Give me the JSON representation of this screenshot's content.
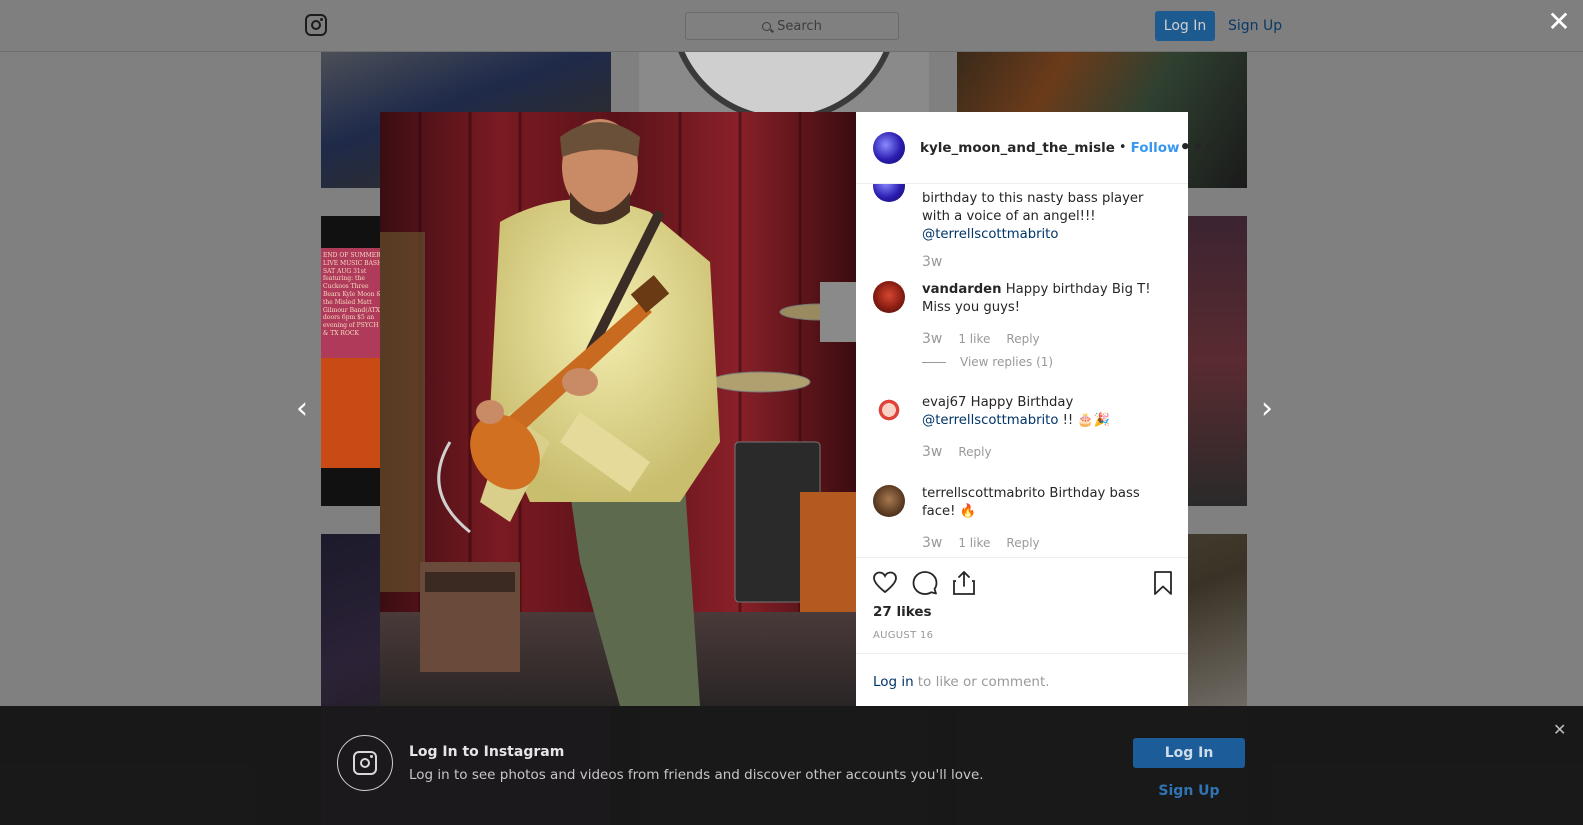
{
  "header": {
    "search_placeholder": "Search",
    "login_label": "Log In",
    "signup_label": "Sign Up",
    "close_label": "✕"
  },
  "nav": {
    "prev_label": "‹",
    "next_label": "›"
  },
  "post": {
    "username": "kyle_moon_and_the_misle",
    "separator": "•",
    "follow_label": "Follow",
    "more_label": "•••",
    "caption": {
      "text": "birthday to this nasty bass player with a voice of an angel!!!",
      "mention": "@terrellscottmabrito",
      "ago": "3w"
    },
    "comments": [
      {
        "username": "vandarden",
        "text": "Happy birthday Big T! Miss you guys!",
        "ago": "3w",
        "likes": "1 like",
        "reply": "Reply",
        "view_replies": "View replies (1)"
      },
      {
        "username": "evaj67",
        "text": "Happy Birthday",
        "mention": "@terrellscottmabrito",
        "suffix": "!! 🎂🎉",
        "ago": "3w",
        "reply": "Reply"
      },
      {
        "username": "terrellscottmabrito",
        "text": "Birthday bass face! 🔥",
        "ago": "3w",
        "likes": "1 like",
        "reply": "Reply"
      }
    ],
    "likes_count": "27 likes",
    "date": "AUGUST 16",
    "login_prompt": {
      "link": "Log in",
      "text": "to like or comment."
    }
  },
  "tiles": {
    "poster_text": "END OF SUMMER LIVE MUSIC BASH SAT AUG 31st featuring: the Cuckoos Three Bears Kyle Moon & the Misled Matt Gilmour Band(ATX) doors 6pm $5 an evening of PSYCH & TX ROCK"
  },
  "banner": {
    "title": "Log In to Instagram",
    "subtitle": "Log in to see photos and videos from friends and discover other accounts you'll love.",
    "login_label": "Log In",
    "signup_label": "Sign Up",
    "close_label": "✕"
  }
}
